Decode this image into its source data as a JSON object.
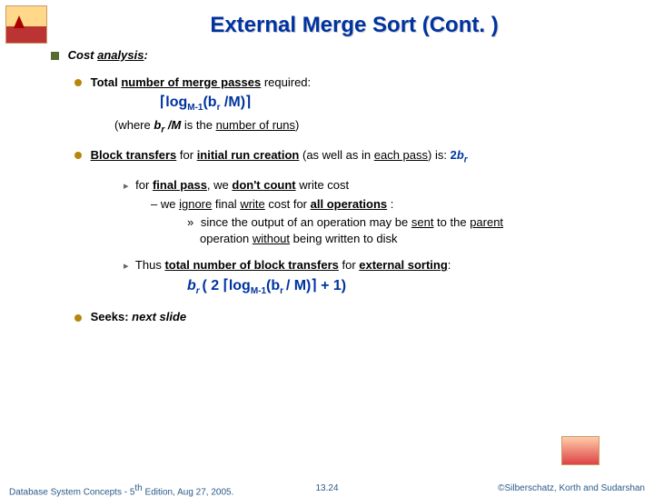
{
  "title": "External Merge Sort (Cont. )",
  "h1_prefix": "Cost ",
  "h1_rest": "analysis",
  "l1_t1": "Total ",
  "l1_t2": "number of merge passes",
  "l1_t3": " required:",
  "f1_a": "⌈log",
  "f1_b": "M-1",
  "f1_c": "(b",
  "f1_d": "r",
  "f1_e": " /M)⌉",
  "where_1": "(where ",
  "where_2": "b",
  "where_2s": "r",
  "where_3": " /M",
  "where_4": " is the ",
  "where_5": "number of runs",
  "where_6": ")",
  "l2_t1": "Block transfers",
  "l2_t2": " for ",
  "l2_t3": "initial run creation",
  "l2_t4": " (as well as in ",
  "l2_t5": "each pass",
  "l2_t6": ") is: ",
  "l2_t7": "2",
  "l2_t8": "b",
  "l2_t8s": "r",
  "l3_t1": "for ",
  "l3_t2": "final pass",
  "l3_t3": ", we ",
  "l3_t4": "don't count",
  "l3_t5": " write cost",
  "l4_dash": "–",
  "l4_t1": "we ",
  "l4_t2": "ignore",
  "l4_t3": " final ",
  "l4_t4": "write",
  "l4_t5": " cost for ",
  "l4_t6": "all operations",
  "l4_t7": " :",
  "l5_g": "»",
  "l5_t1": "since the output of an operation may be ",
  "l5_t2": "sent",
  "l5_t3": " to the ",
  "l5_t4": "parent",
  "l5_t5": "operation ",
  "l5_t6": "without",
  "l5_t7": " being written to disk",
  "l6_t1": "Thus ",
  "l6_t2": "total number of block transfers",
  "l6_t3": " for ",
  "l6_t4": "external sorting",
  "l6_t5": ":",
  "f2_a": "b",
  "f2_as": "r ",
  "f2_b": "( 2 ⌈log",
  "f2_c": "M-1",
  "f2_d": "(b",
  "f2_ds": "r ",
  "f2_e": "/ M)⌉ + 1)",
  "l7_t1": "Seeks: ",
  "l7_t2": "next slide",
  "footer_left_a": "Database System Concepts - 5",
  "footer_left_b": "th",
  "footer_left_c": " Edition, Aug 27, 2005.",
  "footer_mid": "13.24",
  "footer_right": "©Silberschatz, Korth and Sudarshan"
}
